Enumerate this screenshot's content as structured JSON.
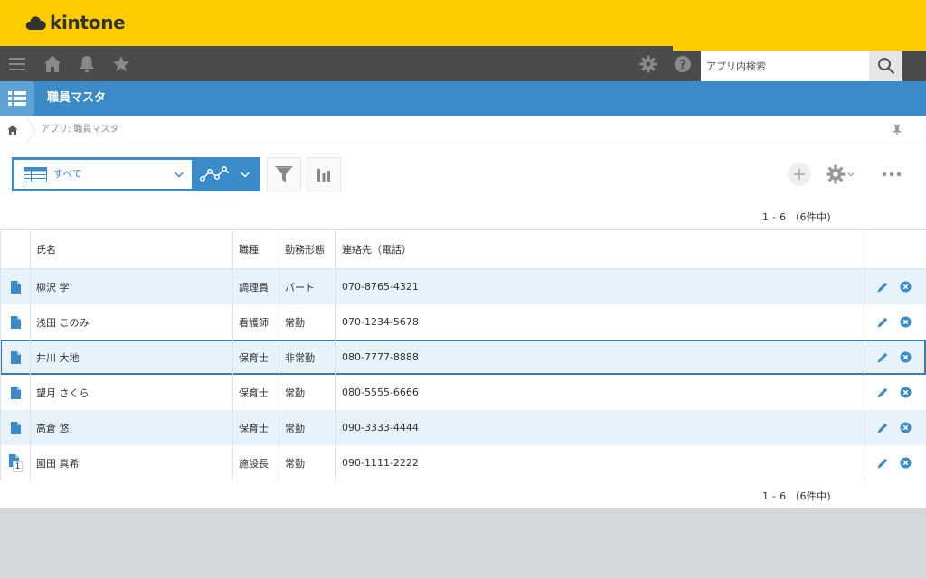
{
  "brand": {
    "name": "kintone"
  },
  "nav": {
    "search_placeholder": "アプリ内検索",
    "icons": [
      "menu-icon",
      "home-icon",
      "bell-icon",
      "star-icon",
      "gear-icon",
      "help-icon",
      "search-icon"
    ]
  },
  "app": {
    "title": "職員マスタ"
  },
  "breadcrumb": {
    "text": "アプリ: 職員マスタ"
  },
  "toolbar": {
    "view_label": "すべて"
  },
  "pager": {
    "top": "1 - 6 （6件中)",
    "bottom": "1 - 6 （6件中)"
  },
  "table": {
    "headers": {
      "name": "氏名",
      "job": "職種",
      "type": "勤務形態",
      "phone": "連絡先（電話）"
    },
    "rows": [
      {
        "name": "柳沢 学",
        "job": "調理員",
        "type": "パート",
        "phone": "070-8765-4321"
      },
      {
        "name": "浅田 このみ",
        "job": "看護師",
        "type": "常勤",
        "phone": "070-1234-5678"
      },
      {
        "name": "井川 大地",
        "job": "保育士",
        "type": "非常勤",
        "phone": "080-7777-8888"
      },
      {
        "name": "望月 さくら",
        "job": "保育士",
        "type": "常勤",
        "phone": "080-5555-6666"
      },
      {
        "name": "高倉 悠",
        "job": "保育士",
        "type": "常勤",
        "phone": "090-3333-4444"
      },
      {
        "name": "園田 真希",
        "job": "施設長",
        "type": "常勤",
        "phone": "090-1111-2222",
        "badge": "1"
      }
    ]
  },
  "colors": {
    "brand_yellow": "#ffcc00",
    "nav_dark": "#4b4b4b",
    "accent_blue": "#3b8bc8",
    "row_alt": "#e8f2fb"
  }
}
